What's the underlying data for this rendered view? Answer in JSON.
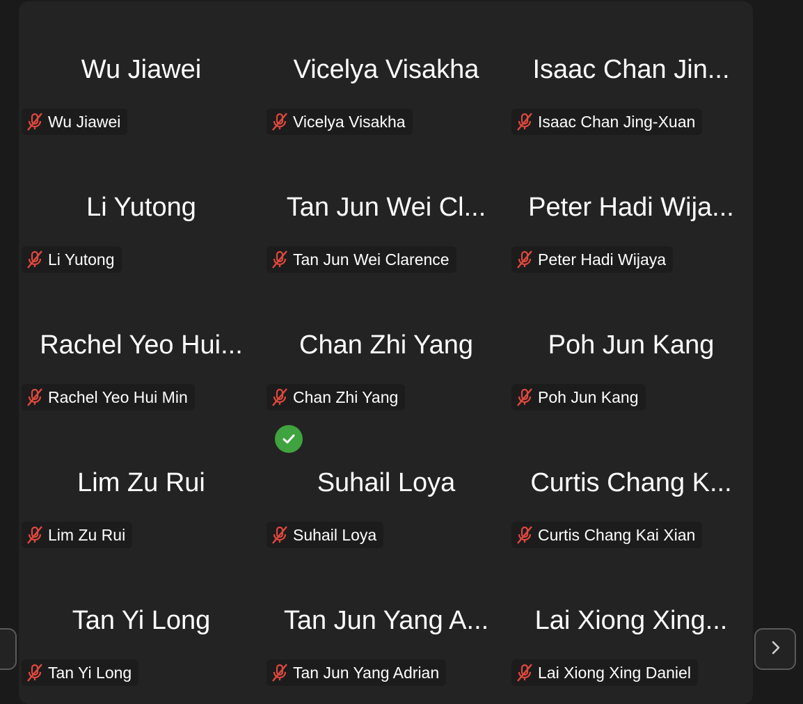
{
  "participants": [
    {
      "display": "Wu Jiawei",
      "label": "Wu Jiawei",
      "muted": true
    },
    {
      "display": "Vicelya Visakha",
      "label": "Vicelya Visakha",
      "muted": true
    },
    {
      "display": "Isaac Chan Jin...",
      "label": "Isaac Chan Jing-Xuan",
      "muted": true
    },
    {
      "display": "Li Yutong",
      "label": "Li Yutong",
      "muted": true
    },
    {
      "display": "Tan Jun Wei Cl...",
      "label": "Tan Jun Wei Clarence",
      "muted": true
    },
    {
      "display": "Peter Hadi Wija...",
      "label": "Peter Hadi Wijaya",
      "muted": true
    },
    {
      "display": "Rachel Yeo Hui...",
      "label": "Rachel Yeo Hui Min",
      "muted": true
    },
    {
      "display": "Chan Zhi Yang",
      "label": "Chan Zhi Yang",
      "muted": true
    },
    {
      "display": "Poh Jun Kang",
      "label": "Poh Jun Kang",
      "muted": true
    },
    {
      "display": "Lim Zu Rui",
      "label": "Lim Zu Rui",
      "muted": true
    },
    {
      "display": "Suhail Loya",
      "label": "Suhail Loya",
      "muted": true,
      "verified": true
    },
    {
      "display": "Curtis Chang K...",
      "label": "Curtis Chang Kai Xian",
      "muted": true
    },
    {
      "display": "Tan Yi Long",
      "label": "Tan Yi Long",
      "muted": true
    },
    {
      "display": "Tan Jun Yang A...",
      "label": "Tan Jun Yang Adrian",
      "muted": true
    },
    {
      "display": "Lai Xiong Xing...",
      "label": "Lai Xiong Xing Daniel",
      "muted": true
    }
  ],
  "icons": {
    "mute": "microphone-muted-icon",
    "check": "checkmark-icon",
    "prev": "chevron-left-icon",
    "next": "chevron-right-icon"
  },
  "colors": {
    "tile_bg": "#232323",
    "mute_red": "#e0483e",
    "check_green": "#3fa33f"
  }
}
